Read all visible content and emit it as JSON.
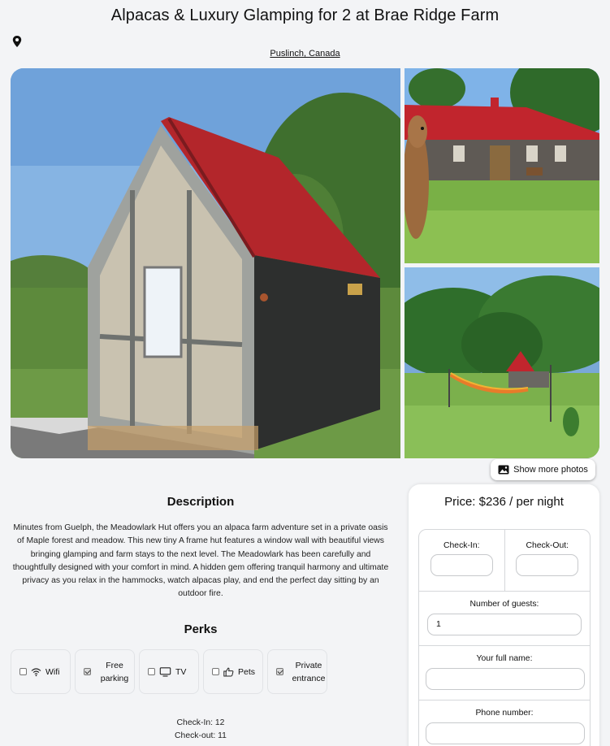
{
  "listing": {
    "title": "Alpacas & Luxury Glamping for 2 at Brae Ridge Farm",
    "location": "Puslinch, Canada",
    "pin_icon": "map-pin-icon"
  },
  "gallery": {
    "show_more_label": "Show more photos",
    "show_more_icon": "image-icon"
  },
  "description": {
    "heading": "Description",
    "text": "Minutes from Guelph, the Meadowlark Hut offers you an alpaca farm adventure set in a private oasis of Maple forest and meadow. This new tiny A frame hut features a window wall with beautiful views bringing glamping and farm stays to the next level. The Meadowlark has been carefully and thoughtfully designed with your comfort in mind. A hidden gem offering tranquil harmony and ultimate privacy as you relax in the hammocks, watch alpacas play, and end the perfect day sitting by an outdoor fire."
  },
  "perks": {
    "heading": "Perks",
    "items": [
      {
        "label": "Wifi",
        "checked": false,
        "icon": "wifi-icon"
      },
      {
        "label": "Free parking",
        "checked": true,
        "icon": "none"
      },
      {
        "label": "TV",
        "checked": false,
        "icon": "tv-icon"
      },
      {
        "label": "Pets",
        "checked": false,
        "icon": "thumbs-up-icon"
      },
      {
        "label": "Private entrance",
        "checked": true,
        "icon": "none"
      }
    ]
  },
  "checkinfo": {
    "check_in": "Check-In: 12",
    "check_out": "Check-out: 11"
  },
  "booking": {
    "price": "Price: $236 / per night",
    "check_in_label": "Check-In:",
    "check_out_label": "Check-Out:",
    "guests_label": "Number of guests:",
    "guests_value": "1",
    "name_label": "Your full name:",
    "phone_label": "Phone number:"
  }
}
